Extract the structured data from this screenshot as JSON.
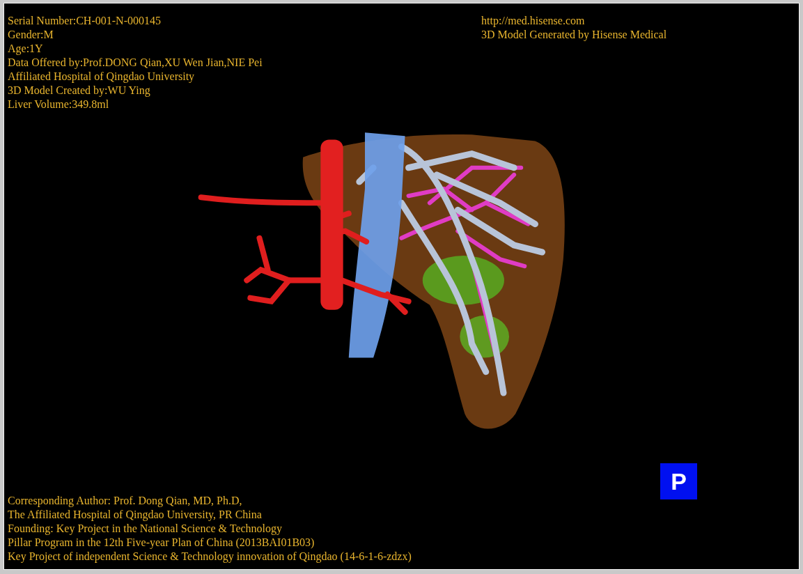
{
  "info_lines": [
    "Serial Number:CH-001-N-000145",
    "Gender:M",
    "Age:1Y",
    "Data Offered by:Prof.DONG Qian,XU Wen Jian,NIE Pei",
    "Affiliated Hospital of Qingdao University",
    "3D Model Created by:WU Ying",
    "Liver Volume:349.8ml"
  ],
  "credit_lines": [
    "http://med.hisense.com",
    "3D Model Generated by Hisense Medical"
  ],
  "projection_button": {
    "label": "P"
  },
  "footer_lines": [
    "Corresponding Author: Prof. Dong Qian, MD, Ph.D,",
    "The Affiliated Hospital of Qingdao University, PR China",
    "Founding: Key Project in the National Science & Technology",
    "Pillar Program in the 12th Five-year Plan of China (2013BAI01B03)",
    "Key Project of independent Science & Technology innovation of Qingdao (14-6-1-6-zdzx)"
  ]
}
